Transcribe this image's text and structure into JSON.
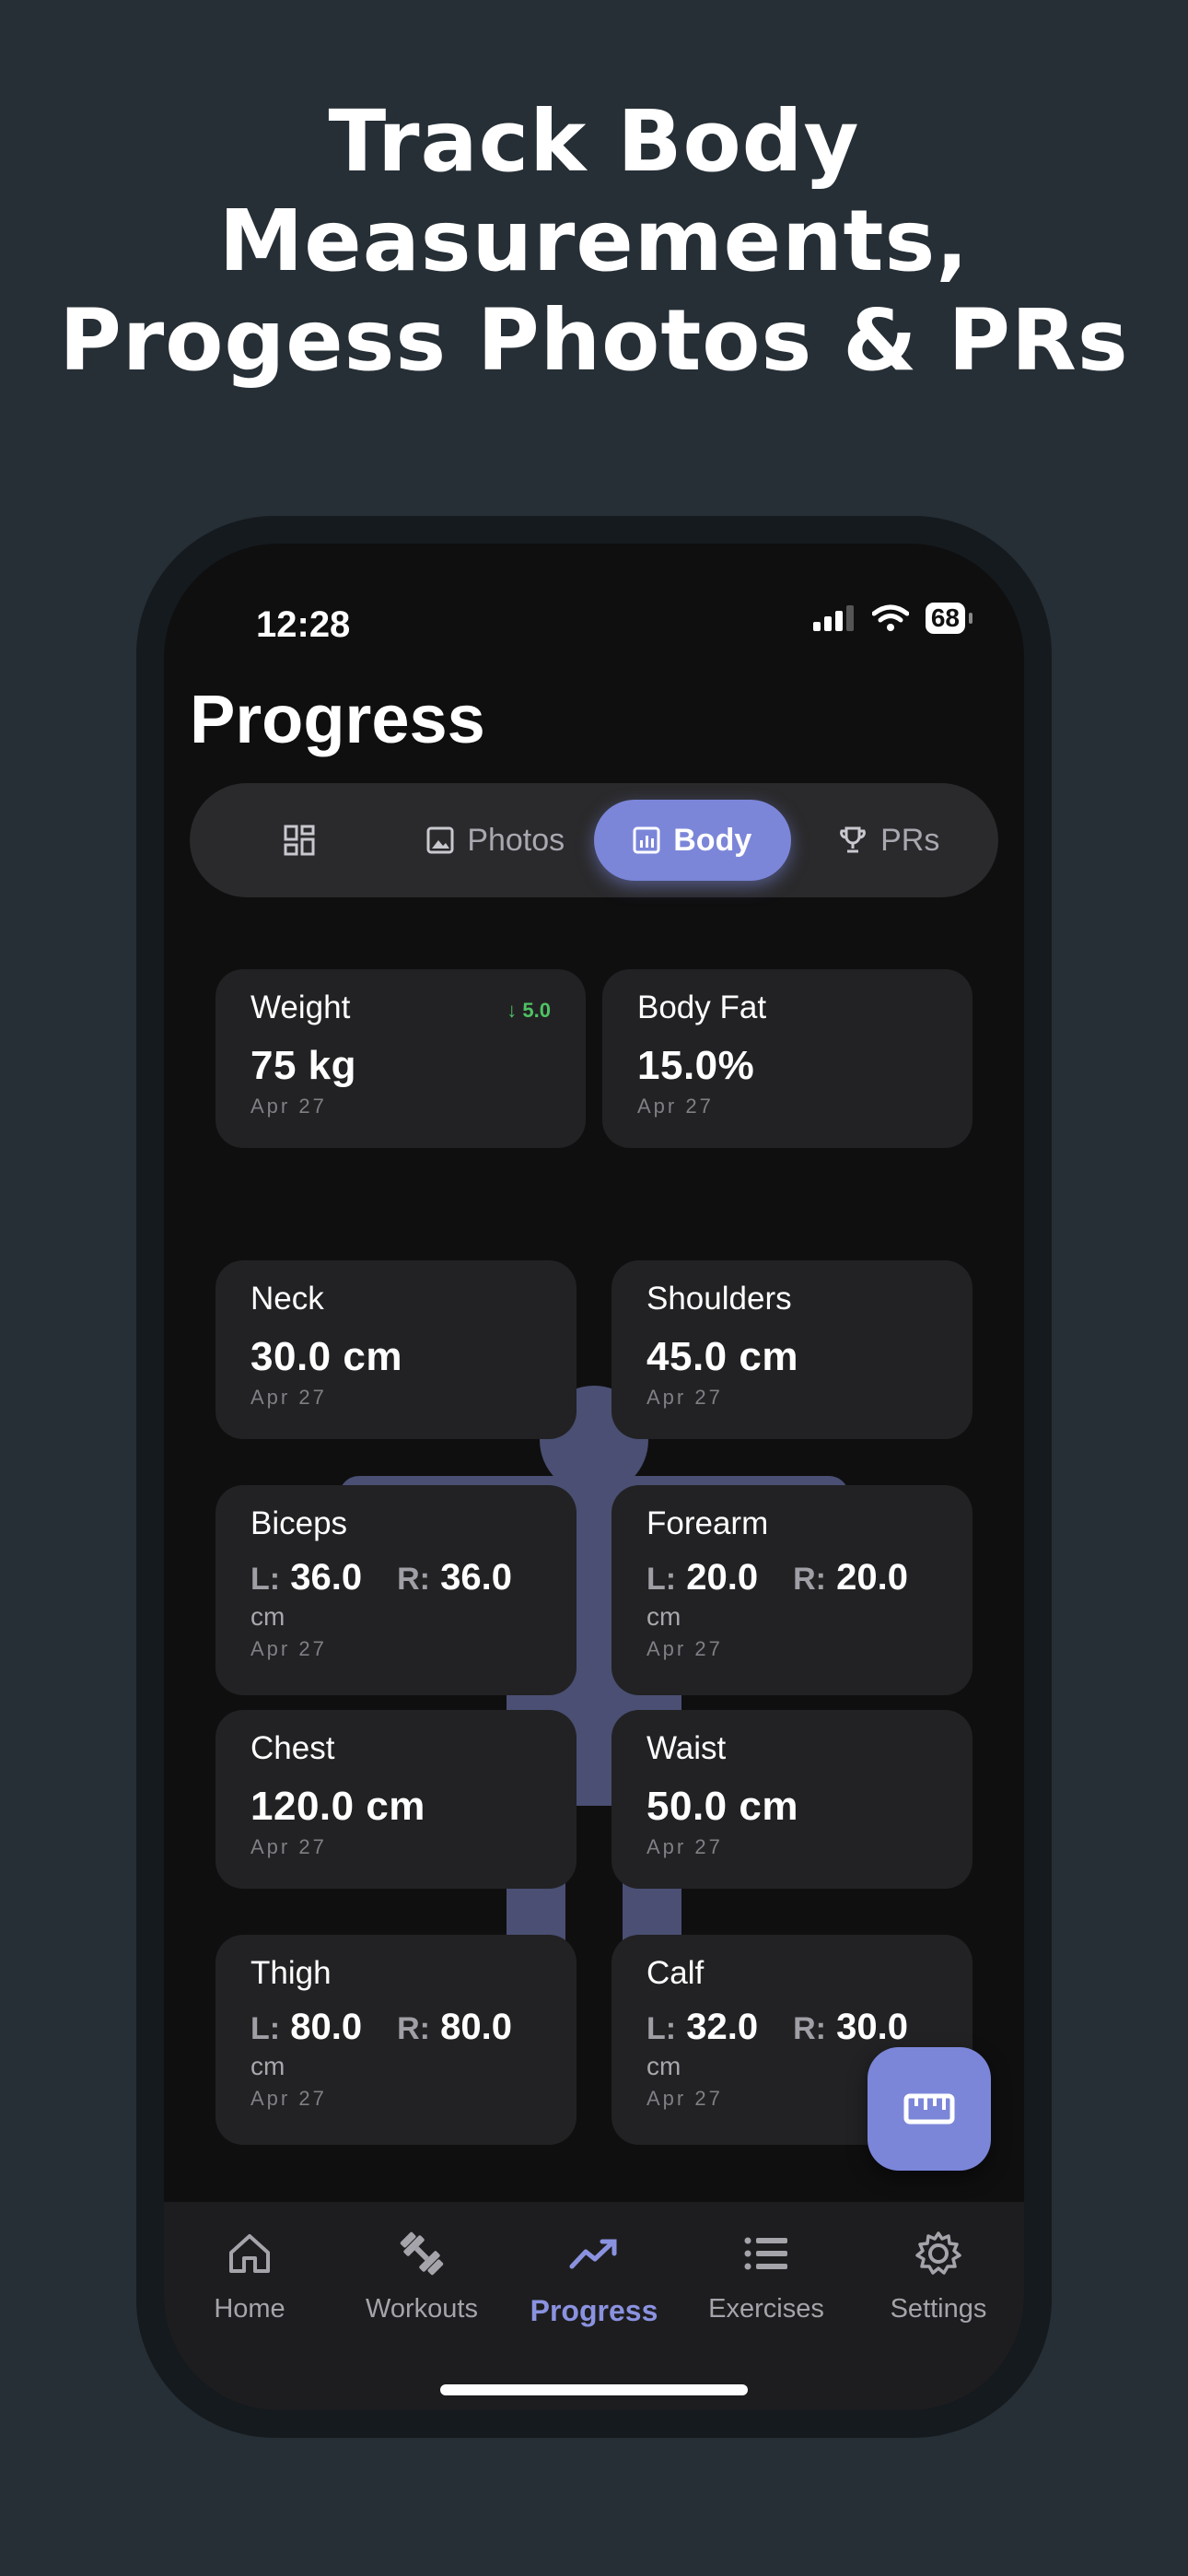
{
  "headline": [
    "Track Body",
    "Measurements,",
    "Progess Photos & PRs"
  ],
  "status": {
    "time": "12:28",
    "battery": "68"
  },
  "page_title": "Progress",
  "tabs_top": [
    {
      "label": "",
      "icon": "grid-icon"
    },
    {
      "label": "Photos",
      "icon": "image-icon"
    },
    {
      "label": "Body",
      "icon": "chart-icon",
      "active": true
    },
    {
      "label": "PRs",
      "icon": "trophy-icon"
    }
  ],
  "cards": {
    "weight": {
      "label": "Weight",
      "value": "75 kg",
      "date": "Apr 27",
      "change": "↓ 5.0"
    },
    "body_fat": {
      "label": "Body Fat",
      "value": "15.0%",
      "date": "Apr 27"
    },
    "neck": {
      "label": "Neck",
      "value": "30.0 cm",
      "date": "Apr 27"
    },
    "shoulders": {
      "label": "Shoulders",
      "value": "45.0 cm",
      "date": "Apr 27"
    },
    "biceps": {
      "label": "Biceps",
      "left_key": "L:",
      "left": "36.0",
      "right_key": "R:",
      "right": "36.0",
      "unit": "cm",
      "date": "Apr 27"
    },
    "forearm": {
      "label": "Forearm",
      "left_key": "L:",
      "left": "20.0",
      "right_key": "R:",
      "right": "20.0",
      "unit": "cm",
      "date": "Apr 27"
    },
    "chest": {
      "label": "Chest",
      "value": "120.0 cm",
      "date": "Apr 27"
    },
    "waist": {
      "label": "Waist",
      "value": "50.0 cm",
      "date": "Apr 27"
    },
    "thigh": {
      "label": "Thigh",
      "left_key": "L:",
      "left": "80.0",
      "right_key": "R:",
      "right": "80.0",
      "unit": "cm",
      "date": "Apr 27"
    },
    "calf": {
      "label": "Calf",
      "left_key": "L:",
      "left": "32.0",
      "right_key": "R:",
      "right": "30.0",
      "unit": "cm",
      "date": "Apr 27"
    }
  },
  "bottom_tabs": [
    {
      "label": "Home",
      "icon": "home-icon"
    },
    {
      "label": "Workouts",
      "icon": "dumbbell-icon"
    },
    {
      "label": "Progress",
      "icon": "trend-icon",
      "active": true
    },
    {
      "label": "Exercises",
      "icon": "list-icon"
    },
    {
      "label": "Settings",
      "icon": "gear-icon"
    }
  ],
  "colors": {
    "accent": "#7b86d9",
    "background": "#262f36",
    "card": "#222224",
    "positive": "#4fc264"
  }
}
